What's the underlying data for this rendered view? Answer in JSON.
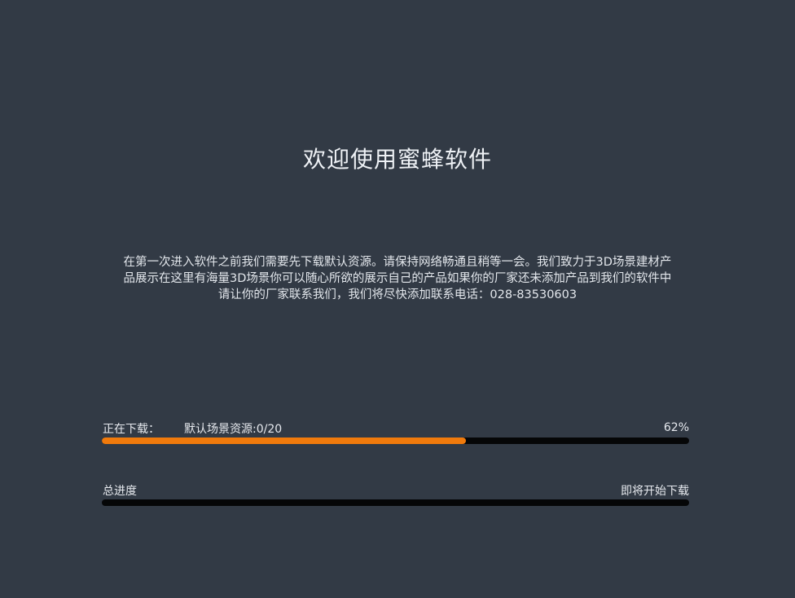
{
  "title": "欢迎使用蜜蜂软件",
  "description": "在第一次进入软件之前我们需要先下载默认资源。请保持网络畅通且稍等一会。我们致力于3D场景建材产品展示在这里有海量3D场景你可以随心所欲的展示自己的产品如果你的厂家还未添加产品到我们的软件中请让你的厂家联系我们，我们将尽快添加联系电话：028-83530603",
  "download": {
    "status_label": "正在下载：",
    "resource_label": "默认场景资源:0/20",
    "percent_label": "62%",
    "progress": 0.62
  },
  "total": {
    "label": "总进度",
    "status_label": "即将开始下载",
    "progress": 0
  },
  "colors": {
    "background": "#323a45",
    "track": "#050607",
    "accent": "#f07a0c"
  }
}
